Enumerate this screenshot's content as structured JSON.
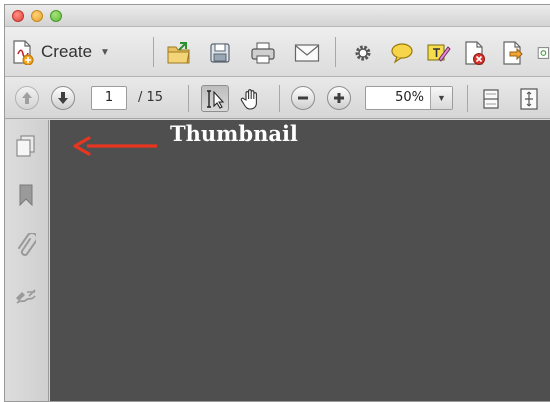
{
  "toolbar": {
    "create_label": "Create",
    "icons": [
      "open-folder-icon",
      "save-icon",
      "print-icon",
      "email-icon",
      "gear-icon",
      "comment-icon",
      "sticky-note-icon",
      "pdf-delete-icon",
      "export-icon",
      "extra-icon"
    ]
  },
  "navigation": {
    "page_number": "1",
    "page_total": "/ 15",
    "zoom_value": "50%"
  },
  "sidebar": {
    "icons": [
      "pages-icon",
      "bookmark-icon",
      "attachment-icon",
      "signature-icon"
    ]
  },
  "annotation": {
    "label": "Thumbnail",
    "color": "#e8351f"
  },
  "colors": {
    "document_background": "#4f4f4f",
    "sidebar_background": "#d6d6d6"
  }
}
